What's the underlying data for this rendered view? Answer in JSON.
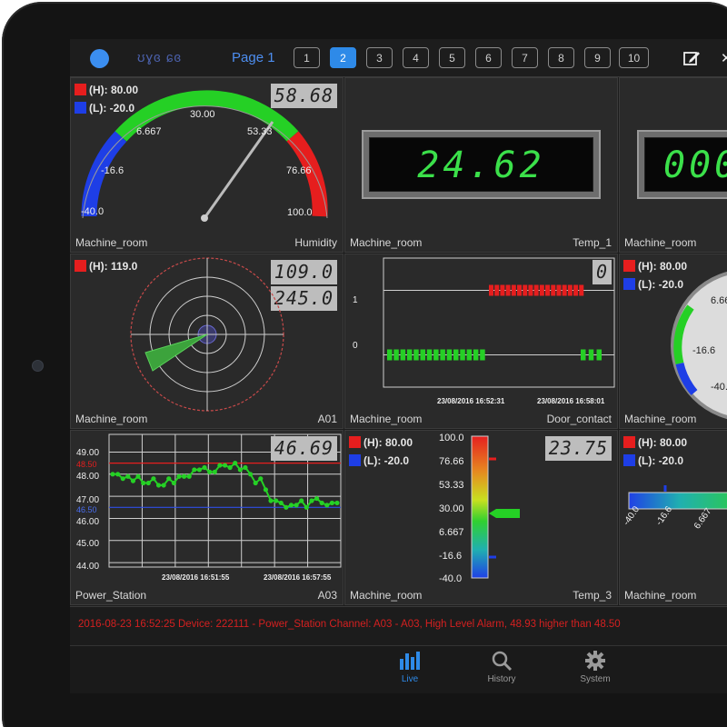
{
  "topbar": {
    "connection_glyphs": "ʊɣɞ ɕɞ",
    "page_label": "Page 1",
    "pages": [
      "1",
      "2",
      "3",
      "4",
      "5",
      "6",
      "7",
      "8",
      "9",
      "10"
    ],
    "active_page": "2",
    "colors": {
      "accent": "#2e8ae8"
    }
  },
  "widgets": {
    "humidity_gauge": {
      "value": "58.68",
      "high_label": "(H): 80.00",
      "low_label": "(L): -20.0",
      "ticks": [
        "-40.0",
        "-16.6",
        "6.667",
        "30.00",
        "53.33",
        "76.66",
        "100.0"
      ],
      "min": -40,
      "max": 100,
      "needle_value": 58.68,
      "caption_left": "Machine_room",
      "caption_right": "Humidity"
    },
    "temp1_display": {
      "value": "24.62",
      "caption_left": "Machine_room",
      "caption_right": "Temp_1"
    },
    "partial_display": {
      "value": "000",
      "caption_left": "Machine_room"
    },
    "radar_a01": {
      "value_top": "109.0",
      "value_bottom": "245.0",
      "high_label": "(H): 119.0",
      "caption_left": "Machine_room",
      "caption_right": "A01"
    },
    "door_contact_chart": {
      "value": "0",
      "y_labels": [
        "1",
        "0"
      ],
      "x_labels": [
        "23/08/2016 16:52:31",
        "23/08/2016 16:58:01"
      ],
      "caption_left": "Machine_room",
      "caption_right": "Door_contact"
    },
    "partial_gauge": {
      "high_label": "(H): 80.00",
      "low_label": "(L): -20.0",
      "ticks": [
        "6.66",
        "-16.6",
        "-40."
      ],
      "caption_left": "Machine_room"
    },
    "power_station_chart": {
      "value": "46.69",
      "y_labels": [
        "49.00",
        "48.50",
        "48.00",
        "47.00",
        "46.50",
        "46.00",
        "45.00",
        "44.00"
      ],
      "x_labels": [
        "23/08/2016 16:51:55",
        "23/08/2016 16:57:55"
      ],
      "high_limit": "48.50",
      "low_limit": "46.50",
      "caption_left": "Power_Station",
      "caption_right": "A03"
    },
    "temp3_bar": {
      "value": "23.75",
      "high_label": "(H): 80.00",
      "low_label": "(L): -20.0",
      "scale": [
        "100.0",
        "76.66",
        "53.33",
        "30.00",
        "6.667",
        "-16.6",
        "-40.0"
      ],
      "caption_left": "Machine_room",
      "caption_right": "Temp_3"
    },
    "partial_hbar": {
      "high_label": "(H): 80.00",
      "low_label": "(L): -20.0",
      "scale": [
        "-40.0",
        "-16.6",
        "6.667"
      ],
      "caption_left": "Machine_room"
    }
  },
  "chart_data": [
    {
      "type": "line",
      "series": [
        {
          "values": [
            48.0,
            48.0,
            47.8,
            47.9,
            47.7,
            47.9,
            47.6,
            47.6,
            47.8,
            47.5,
            47.5,
            47.8,
            47.6,
            47.9,
            47.9,
            47.9,
            48.2,
            48.2,
            48.3,
            48.1,
            48.1,
            48.4,
            48.4,
            48.3,
            48.5,
            48.2,
            48.3,
            48.0,
            47.6,
            47.8,
            47.3,
            46.8,
            46.8,
            46.7,
            46.5,
            46.6,
            46.6,
            46.8,
            46.5,
            46.8,
            46.9,
            46.7,
            46.6,
            46.7,
            46.7
          ]
        }
      ],
      "ylim": [
        43.8,
        49.8
      ]
    },
    {
      "type": "scatter",
      "series": [
        {
          "values": [
            0,
            0,
            0,
            0,
            0,
            0,
            0,
            0,
            0,
            0,
            0,
            0,
            0,
            0,
            0,
            0,
            0,
            0
          ]
        },
        {
          "values": [
            1,
            1,
            1,
            1,
            1,
            1,
            1,
            1,
            1,
            1,
            1,
            1,
            1,
            1,
            1,
            1,
            1
          ]
        }
      ],
      "ylim": [
        -0.5,
        1.5
      ]
    }
  ],
  "alarm": {
    "message": "2016-08-23 16:52:25 Device: 222111 - Power_Station   Channel: A03 - A03, High Level Alarm, 48.93 higher than 48.50",
    "color": "#d42020"
  },
  "tabs": [
    {
      "label": "Live",
      "icon": "bar-chart-icon"
    },
    {
      "label": "History",
      "icon": "search-icon"
    },
    {
      "label": "System",
      "icon": "gear-icon"
    }
  ]
}
